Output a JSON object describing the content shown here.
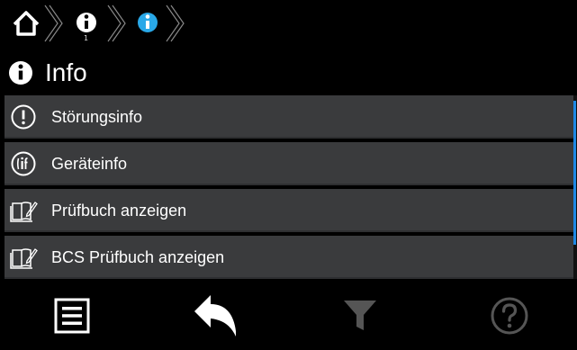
{
  "breadcrumb": {
    "items": [
      {
        "icon": "home-icon"
      },
      {
        "icon": "info-icon",
        "sub": "1"
      },
      {
        "icon": "info-icon-active"
      }
    ]
  },
  "header": {
    "title": "Info",
    "icon": "info-icon"
  },
  "list": {
    "items": [
      {
        "label": "Störungsinfo",
        "icon": "exclamation-circle-icon"
      },
      {
        "label": "Geräteinfo",
        "icon": "device-info-icon"
      },
      {
        "label": "Prüfbuch anzeigen",
        "icon": "book-icon"
      },
      {
        "label": "BCS Prüfbuch anzeigen",
        "icon": "book-icon"
      }
    ]
  },
  "toolbar": {
    "buttons": [
      {
        "icon": "menu-icon"
      },
      {
        "icon": "back-arrow-icon"
      },
      {
        "icon": "filter-icon"
      },
      {
        "icon": "help-icon"
      }
    ]
  },
  "colors": {
    "accent": "#1e88e5",
    "list_bg": "#3a3b3d",
    "disabled": "#555555"
  }
}
